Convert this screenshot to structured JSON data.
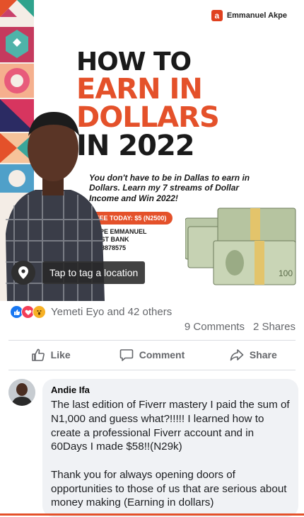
{
  "post": {
    "brand": "Emmanuel Akpe",
    "brand_icon": "brand-logo-icon",
    "headline": [
      "HOW TO",
      "EARN IN",
      "DOLLARS",
      "IN 2022"
    ],
    "subtext": "You don't have to be in Dallas to earn in Dollars. Learn my 7 streams of Dollar Income and Win 2022!",
    "fee": "FEE TODAY: $5 (N2500)",
    "bank_name": "AKPE EMMANUEL",
    "bank": "FIRST BANK",
    "account": "3058878575",
    "tag_prompt": "Tap to tag a location",
    "accent_color": "#e4512a"
  },
  "reactions": {
    "icons": [
      "like-icon",
      "love-icon",
      "wow-icon"
    ],
    "summary": "Yemeti Eyo and 42 others",
    "comments": "9 Comments",
    "shares": "2 Shares"
  },
  "actions": {
    "like": "Like",
    "comment": "Comment",
    "share": "Share"
  },
  "comment": {
    "author": "Andie Ifa",
    "text": "The last edition of Fiverr mastery I paid the sum of N1,000 and guess what?!!!!! I learned how to create a professional Fiverr account and in 60Days I made $58!!(N29k)\n\nThank you for always opening doors of opportunities to those of us that are serious about money making (Earning in dollars)"
  }
}
